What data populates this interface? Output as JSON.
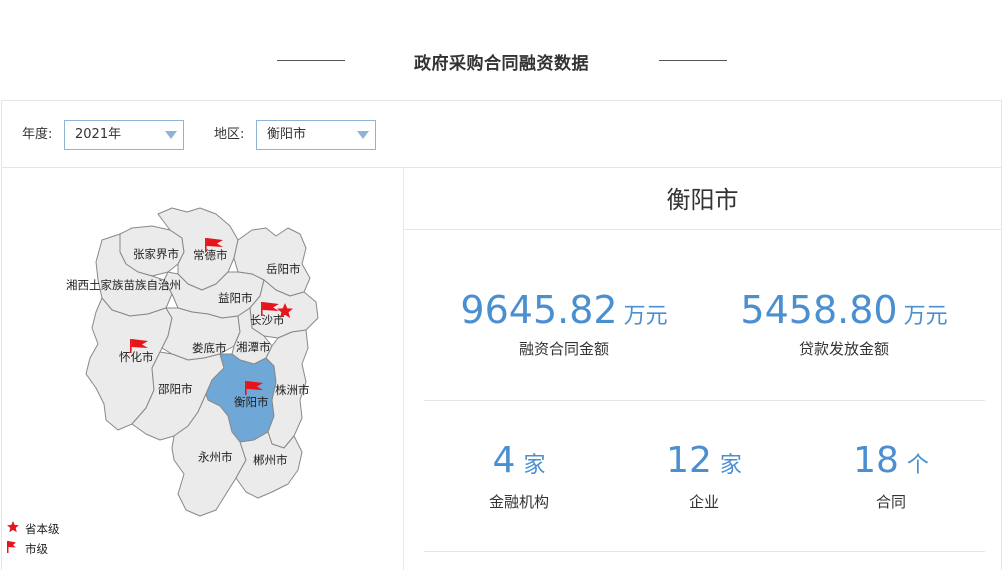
{
  "page": {
    "title": "政府采购合同融资数据"
  },
  "filters": {
    "year_label": "年度:",
    "year_value": "2021年",
    "region_label": "地区:",
    "region_value": "衡阳市"
  },
  "map": {
    "highlight_color": "#6fa8d6",
    "region_fill": "#ebebeb",
    "border_color": "#888888",
    "marker_color": "#e8141b",
    "regions": [
      {
        "name": "张家界市"
      },
      {
        "name": "常德市"
      },
      {
        "name": "岳阳市"
      },
      {
        "name": "湘西土家族苗族自治州"
      },
      {
        "name": "益阳市"
      },
      {
        "name": "长沙市"
      },
      {
        "name": "怀化市"
      },
      {
        "name": "娄底市"
      },
      {
        "name": "湘潭市"
      },
      {
        "name": "邵阳市"
      },
      {
        "name": "衡阳市"
      },
      {
        "name": "株洲市"
      },
      {
        "name": "永州市"
      },
      {
        "name": "郴州市"
      }
    ],
    "legend": [
      {
        "icon": "star-icon",
        "label": "省本级"
      },
      {
        "icon": "flag-icon",
        "label": "市级"
      }
    ]
  },
  "stats": {
    "city": "衡阳市",
    "financing_amount": {
      "value": "9645.82",
      "unit": "万元",
      "caption": "融资合同金额"
    },
    "loan_amount": {
      "value": "5458.80",
      "unit": "万元",
      "caption": "贷款发放金额"
    },
    "institutions": {
      "value": "4",
      "unit": "家",
      "caption": "金融机构"
    },
    "companies": {
      "value": "12",
      "unit": "家",
      "caption": "企业"
    },
    "contracts": {
      "value": "18",
      "unit": "个",
      "caption": "合同"
    }
  }
}
